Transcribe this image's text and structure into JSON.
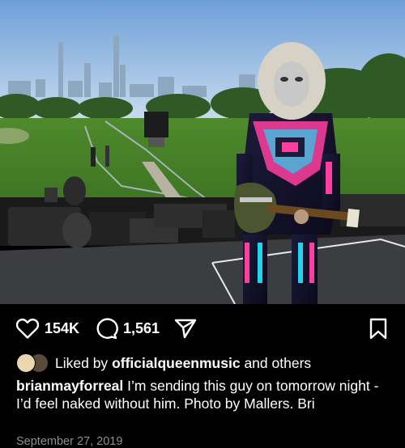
{
  "post": {
    "image_alt": "Guitarist in silver mask and neon costume on stage in Central Park",
    "likes_count": "154K",
    "comments_count": "1,561",
    "liked_by_prefix": "Liked by",
    "liked_by_user": "officialqueenmusic",
    "liked_by_suffix": "and others",
    "author": "brianmayforreal",
    "caption": "I’m sending this guy on tomorrow night - I’d feel naked without him.  Photo by Mallers. Bri",
    "date": "September 27, 2019"
  },
  "icons": {
    "like": "heart-icon",
    "comment": "comment-bubble-icon",
    "share": "send-icon",
    "save": "bookmark-icon"
  },
  "colors": {
    "background": "#000000",
    "text": "#ffffff",
    "muted": "#8e8e8e",
    "costume_pink": "#ff3fa0",
    "costume_cyan": "#22d3ee"
  }
}
